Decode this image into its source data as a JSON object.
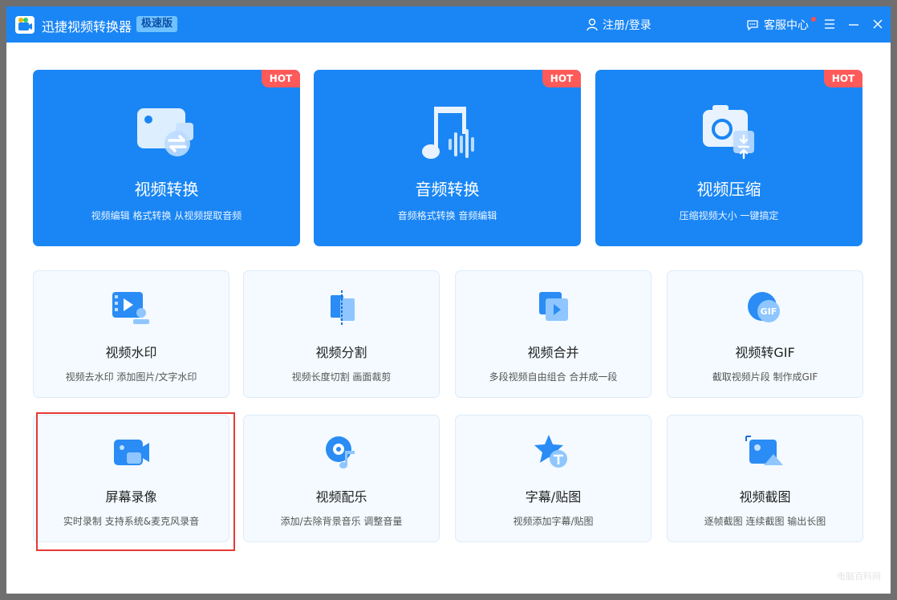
{
  "app": {
    "title": "迅捷视频转换器",
    "edition": "极速版",
    "login": "注册/登录",
    "service": "客服中心"
  },
  "hot_cards": [
    {
      "badge": "HOT",
      "title": "视频转换",
      "desc": "视频编辑 格式转换 从视频提取音频",
      "icon": "video-convert-icon"
    },
    {
      "badge": "HOT",
      "title": "音频转换",
      "desc": "音频格式转换 音频编辑",
      "icon": "audio-convert-icon"
    },
    {
      "badge": "HOT",
      "title": "视频压缩",
      "desc": "压缩视频大小 一键搞定",
      "icon": "video-compress-icon"
    }
  ],
  "tools": [
    {
      "title": "视频水印",
      "desc": "视频去水印 添加图片/文字水印",
      "icon": "watermark-icon"
    },
    {
      "title": "视频分割",
      "desc": "视频长度切割 画面裁剪",
      "icon": "split-icon"
    },
    {
      "title": "视频合并",
      "desc": "多段视频自由组合 合并成一段",
      "icon": "merge-icon"
    },
    {
      "title": "视频转GIF",
      "desc": "截取视频片段 制作成GIF",
      "icon": "gif-icon"
    },
    {
      "title": "屏幕录像",
      "desc": "实时录制 支持系统&麦克风录音",
      "icon": "screen-record-icon"
    },
    {
      "title": "视频配乐",
      "desc": "添加/去除背景音乐 调整音量",
      "icon": "music-icon"
    },
    {
      "title": "字幕/贴图",
      "desc": "视频添加字幕/贴图",
      "icon": "subtitle-icon"
    },
    {
      "title": "视频截图",
      "desc": "逐帧截图 连续截图 输出长图",
      "icon": "screenshot-icon"
    }
  ],
  "gif_label": "GIF",
  "watermark": "电脑百科网",
  "colors": {
    "primary": "#1a86f5",
    "hot": "#ff5a5a",
    "card_bg": "#f4faff",
    "highlight": "#e53935"
  }
}
